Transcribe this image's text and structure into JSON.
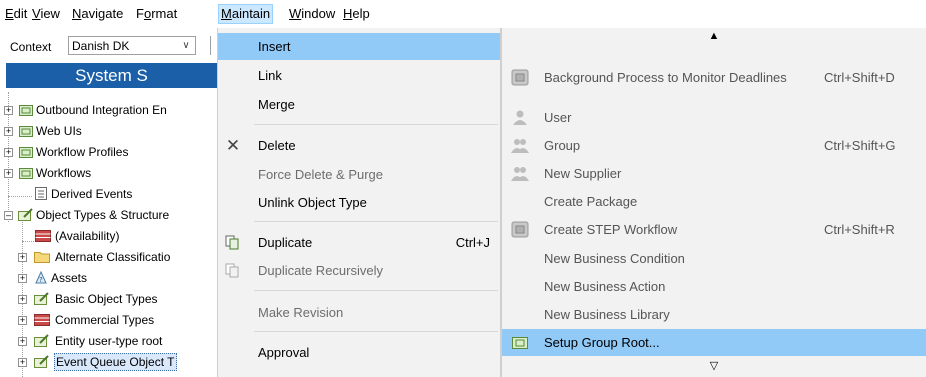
{
  "menubar": {
    "items": [
      {
        "label": "Edit",
        "ul": "E"
      },
      {
        "label": "View",
        "ul": "V"
      },
      {
        "label": "Navigate",
        "ul": "N"
      },
      {
        "label": "Format",
        "ul": "o"
      },
      {
        "label": "Maintain",
        "ul": "M"
      },
      {
        "label": "Window",
        "ul": "W"
      },
      {
        "label": "Help",
        "ul": "H"
      }
    ]
  },
  "context": {
    "label": "Context",
    "value": "Danish DK"
  },
  "system_bar": {
    "title": "System S"
  },
  "tree": {
    "items": [
      {
        "label": "Outbound Integration En"
      },
      {
        "label": "Web UIs"
      },
      {
        "label": "Workflow Profiles"
      },
      {
        "label": "Workflows"
      },
      {
        "label": "Derived Events"
      },
      {
        "label": "Object Types & Structure"
      },
      {
        "label": "(Availability)"
      },
      {
        "label": "Alternate Classificatio"
      },
      {
        "label": "Assets"
      },
      {
        "label": "Basic Object Types"
      },
      {
        "label": "Commercial Types"
      },
      {
        "label": "Entity user-type root"
      },
      {
        "label": "Event Queue Object T"
      }
    ]
  },
  "maintain_menu": {
    "items": [
      {
        "label": "Insert",
        "shortcut": "",
        "disabled": false,
        "highlighted": true,
        "icon": ""
      },
      {
        "label": "Link",
        "shortcut": "",
        "disabled": false,
        "highlighted": false,
        "icon": ""
      },
      {
        "label": "Merge",
        "shortcut": "",
        "disabled": false,
        "highlighted": false,
        "icon": ""
      },
      {
        "label": "Delete",
        "shortcut": "",
        "disabled": false,
        "highlighted": false,
        "icon": "close-icon"
      },
      {
        "label": "Force Delete & Purge",
        "shortcut": "",
        "disabled": true,
        "highlighted": false,
        "icon": ""
      },
      {
        "label": "Unlink Object Type",
        "shortcut": "",
        "disabled": false,
        "highlighted": false,
        "icon": ""
      },
      {
        "label": "Duplicate",
        "shortcut": "Ctrl+J",
        "disabled": false,
        "highlighted": false,
        "icon": "duplicate-icon"
      },
      {
        "label": "Duplicate Recursively",
        "shortcut": "",
        "disabled": true,
        "highlighted": false,
        "icon": "duplicate-recursive-icon"
      },
      {
        "label": "Make Revision",
        "shortcut": "",
        "disabled": true,
        "highlighted": false,
        "icon": ""
      },
      {
        "label": "Approval",
        "shortcut": "",
        "disabled": false,
        "highlighted": false,
        "icon": ""
      }
    ]
  },
  "insert_submenu": {
    "scroll_up": "▲",
    "scroll_down": "▽",
    "items": [
      {
        "label": "Background Process to Monitor Deadlines",
        "shortcut": "Ctrl+Shift+D",
        "icon": "workflow-icon"
      },
      {
        "label": "User",
        "shortcut": "",
        "icon": "user-icon"
      },
      {
        "label": "Group",
        "shortcut": "Ctrl+Shift+G",
        "icon": "group-icon"
      },
      {
        "label": "New Supplier",
        "shortcut": "",
        "icon": "supplier-icon"
      },
      {
        "label": "Create Package",
        "shortcut": "",
        "icon": ""
      },
      {
        "label": "Create STEP Workflow",
        "shortcut": "Ctrl+Shift+R",
        "icon": "workflow-icon"
      },
      {
        "label": "New Business Condition",
        "shortcut": "",
        "icon": ""
      },
      {
        "label": "New Business Action",
        "shortcut": "",
        "icon": ""
      },
      {
        "label": "New Business Library",
        "shortcut": "",
        "icon": ""
      },
      {
        "label": "Setup Group Root...",
        "shortcut": "",
        "icon": "setup-group-icon",
        "highlighted": true
      }
    ]
  },
  "colors": {
    "accent": "#1b5fa8",
    "menu_highlight": "#91c9f7",
    "menu_bg": "#f2f2f2"
  }
}
